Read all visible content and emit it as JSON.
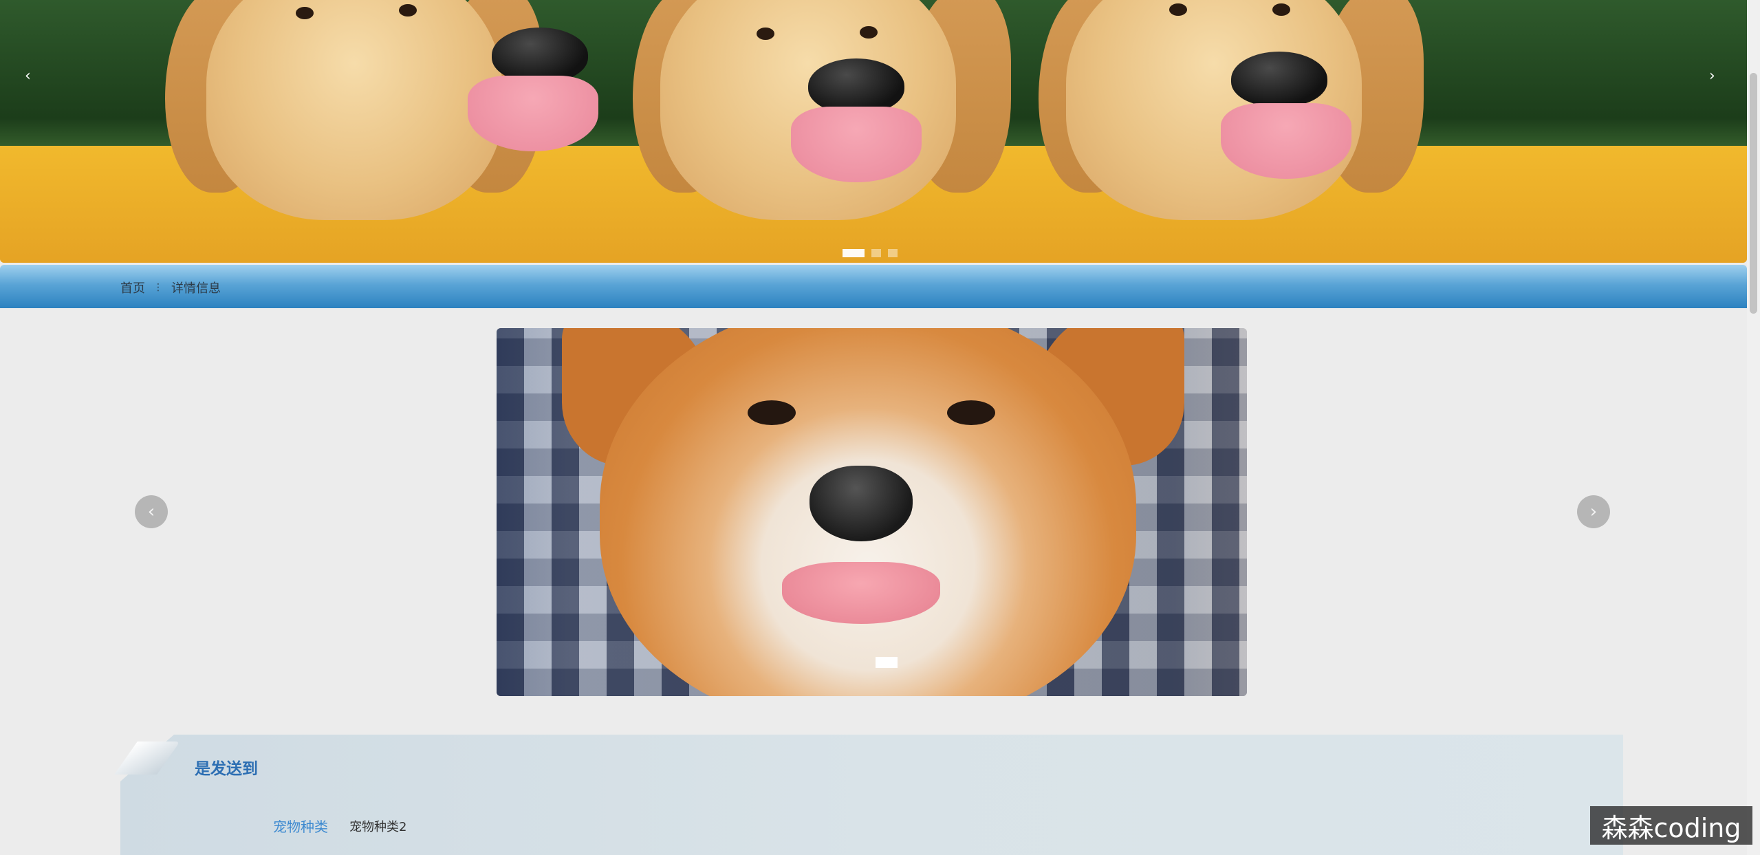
{
  "banner": {
    "prev_icon": "‹",
    "next_icon": "›",
    "slide_count": 3,
    "active_slide": 1
  },
  "breadcrumb": {
    "home": "首页",
    "separator": "⋮",
    "current": "详情信息"
  },
  "gallery": {
    "prev_icon": "‹",
    "next_icon": "›",
    "slide_count": 1,
    "active_slide": 1
  },
  "detail": {
    "title": "是发送到",
    "fields": [
      {
        "label": "宠物种类",
        "value": "宠物种类2"
      }
    ]
  },
  "watermark": "森森coding",
  "colors": {
    "breadcrumb_bar": "#2c82c0",
    "detail_title": "#2d6fb3",
    "field_label": "#3e8ad0",
    "page_bg": "#ececec"
  }
}
